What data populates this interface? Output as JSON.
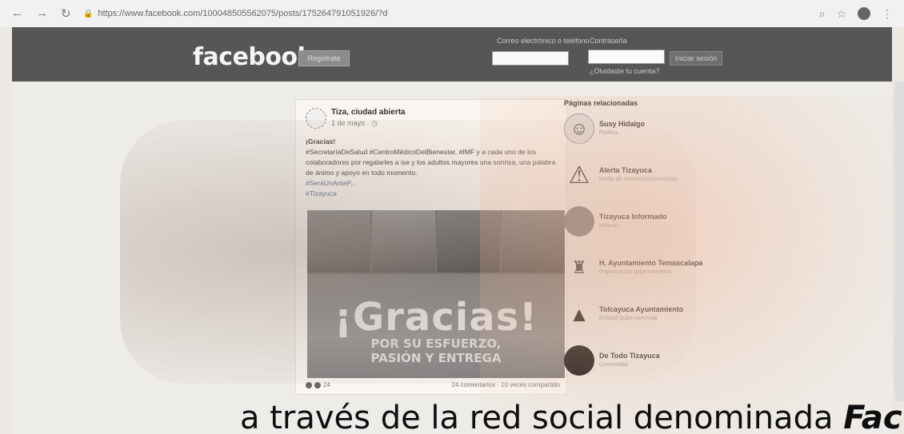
{
  "browser": {
    "url": "https://www.facebook.com/100048505562075/posts/175264791051926/?d"
  },
  "header": {
    "logo": "facebook",
    "register_label": "Registrate",
    "email_label": "Correo electrónico o teléfono",
    "password_label": "Contraseña",
    "forgot_label": "¿Olvidaste tu cuenta?",
    "login_label": "Iniciar sesión"
  },
  "post": {
    "author": "Tiza, ciudad abierta",
    "date": "1 de mayo · ◷",
    "heading": "¡Gracias!",
    "body": "#SecretaríaDeSalud #CentroMédicoDelBienestar, #IMF y a cada uno de los colaboradores por regalarles a ise y los adultos mayores una sonrisa, una palabra de ánimo y apoyo en todo momento.",
    "tags": [
      "#SeráUnAnteP...",
      "#Tizayuca"
    ],
    "image_title": "¡Gracias!",
    "image_line1": "POR SU ESFUERZO,",
    "image_line2": "PASIÓN Y ENTREGA",
    "reactions": "24",
    "footer_text": "24 comentarios · 10 veces compartido"
  },
  "related": {
    "title": "Páginas relacionadas",
    "pages": [
      {
        "name": "Susy Hidalgo",
        "desc": "Política"
      },
      {
        "name": "Alerta Tizayuca",
        "desc": "Medio de comunicación/noticias"
      },
      {
        "name": "Tizayuca Informado",
        "desc": "Noticias"
      },
      {
        "name": "H. Ayuntamiento Temascalapa",
        "desc": "Organización gubernamental"
      },
      {
        "name": "Tolcayuca Ayuntamiento",
        "desc": "Entidad gubernamental"
      },
      {
        "name": "De Todo Tizayuca",
        "desc": "Comunidad"
      }
    ]
  },
  "caption": {
    "text": "a   través   de   la   red   social   denominada",
    "bold": "Fac"
  }
}
